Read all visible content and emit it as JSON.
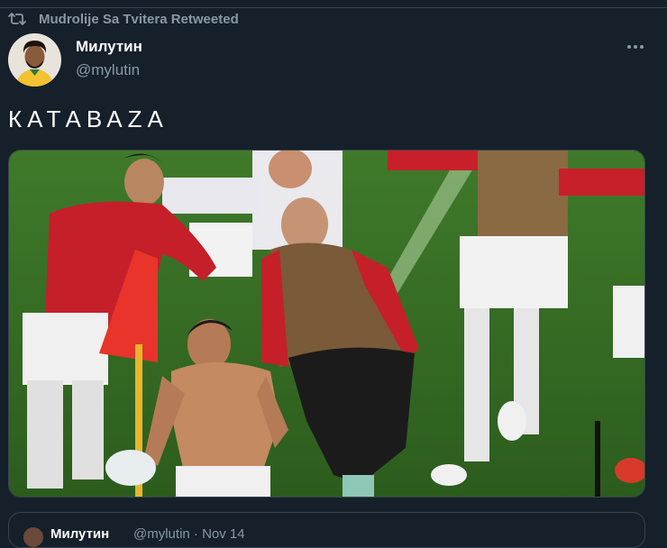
{
  "retweet": {
    "icon": "retweet-icon",
    "label": "Mudrolije Sa Tvitera Retweeted"
  },
  "tweet": {
    "author_name": "Милутин",
    "author_handle": "@mylutin",
    "text": "КАТАВАZА",
    "more_icon": "more-options-icon"
  },
  "media": {
    "description_icon": "photo"
  },
  "quoted": {
    "author_name": "Милутин",
    "meta": "@mylutin · Nov 14"
  },
  "colors": {
    "background": "#15202b",
    "secondary_text": "#8899a6",
    "border": "#38444d",
    "primary_text": "#ffffff"
  }
}
